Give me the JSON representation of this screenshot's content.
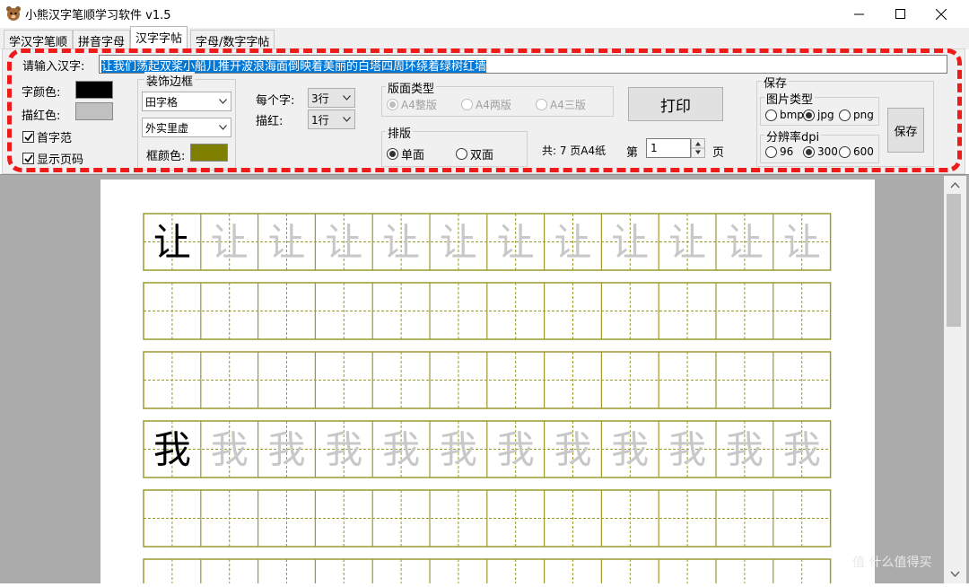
{
  "window": {
    "title": "小熊汉字笔顺学习软件 v1.5",
    "controls": {
      "minimize": "—",
      "maximize": "☐",
      "close": "✕"
    }
  },
  "tabs": [
    {
      "label": "学汉字笔顺",
      "active": false
    },
    {
      "label": "拼音字母",
      "active": false
    },
    {
      "label": "汉字字帖",
      "active": true
    },
    {
      "label": "字母/数字字帖",
      "active": false
    }
  ],
  "panel": {
    "input_label": "请输入汉字:",
    "input_value": "让我们荡起双桨小船儿推开波浪海面倒映着美丽的白塔四周环绕着绿树红墙",
    "char_color_label": "字颜色:",
    "char_color": "#000000",
    "trace_color_label": "描红色:",
    "trace_color": "#c0c0c0",
    "first_char_label": "首字范",
    "first_char_checked": true,
    "show_page_label": "显示页码",
    "show_page_checked": true,
    "border_group": {
      "title": "装饰边框",
      "grid_style": "田字格",
      "line_style": "外实里虚",
      "frame_color_label": "框颜色:",
      "frame_color": "#808000"
    },
    "per_char_label": "每个字:",
    "per_char_value": "3行",
    "trace_label": "描红:",
    "trace_value": "1行",
    "layout_type": {
      "title": "版面类型",
      "options": [
        {
          "label": "A4整版",
          "selected": true
        },
        {
          "label": "A4两版",
          "selected": false
        },
        {
          "label": "A4三版",
          "selected": false
        }
      ]
    },
    "print_button": "打印",
    "arrange": {
      "title": "排版",
      "options": [
        {
          "label": "单面",
          "selected": true
        },
        {
          "label": "双面",
          "selected": false
        }
      ]
    },
    "total_pages": "共: 7 页A4纸",
    "page_prefix": "第",
    "page_value": "1",
    "page_suffix": "页",
    "save_group": {
      "title": "保存",
      "image_type_title": "图片类型",
      "image_types": [
        {
          "label": "bmp",
          "selected": false
        },
        {
          "label": "jpg",
          "selected": true
        },
        {
          "label": "png",
          "selected": false
        }
      ],
      "dpi_title": "分辨率dpi",
      "dpis": [
        {
          "label": "96",
          "selected": false
        },
        {
          "label": "300",
          "selected": true
        },
        {
          "label": "600",
          "selected": false
        }
      ],
      "save_button": "保存"
    }
  },
  "sheet": {
    "grid_color": "#9a9a2e",
    "cells_per_row": 12,
    "rows": [
      {
        "first": "让",
        "trace": "让"
      },
      {
        "first": "",
        "trace": ""
      },
      {
        "first": "",
        "trace": ""
      },
      {
        "first": "我",
        "trace": "我"
      },
      {
        "first": "",
        "trace": ""
      },
      {
        "first": "",
        "trace": ""
      }
    ]
  },
  "watermark": "值 什么值得买"
}
